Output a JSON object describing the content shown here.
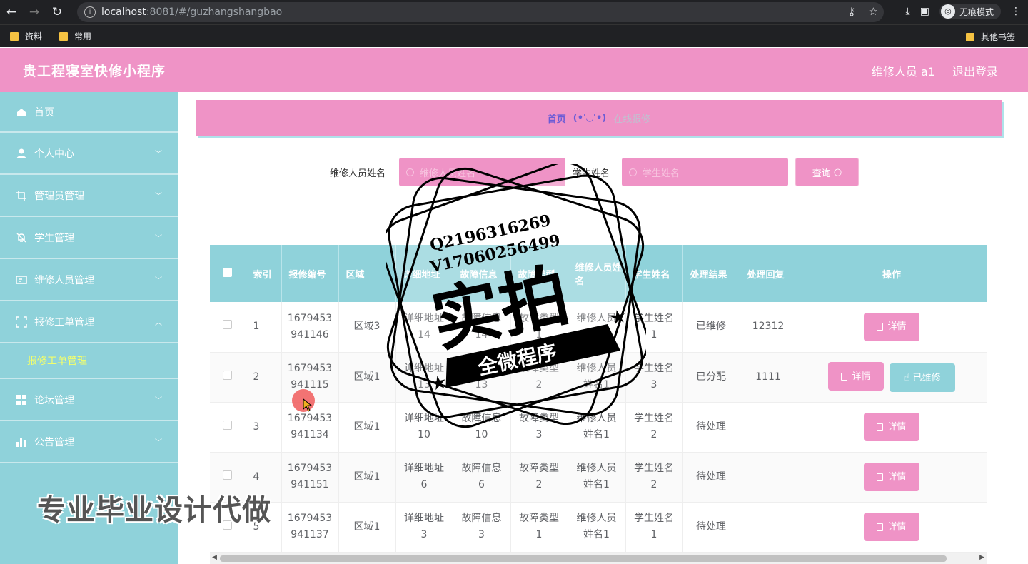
{
  "browser": {
    "url_host": "localhost",
    "url_path": ":8081/#/guzhangshangbao",
    "profile_label": "无痕模式",
    "bookmarks": [
      "资料",
      "常用"
    ],
    "other_bookmarks": "其他书签"
  },
  "header": {
    "title": "贵工程寝室快修小程序",
    "user": "维修人员 a1",
    "logout": "退出登录"
  },
  "sidebar": {
    "items": [
      {
        "label": "首页",
        "icon": "home-icon"
      },
      {
        "label": "个人中心",
        "icon": "user-icon"
      },
      {
        "label": "管理员管理",
        "icon": "crop-icon"
      },
      {
        "label": "学生管理",
        "icon": "bell-off-icon"
      },
      {
        "label": "维修人员管理",
        "icon": "card-icon"
      },
      {
        "label": "报修工单管理",
        "icon": "fullscreen-icon"
      },
      {
        "label": "论坛管理",
        "icon": "grid-icon"
      },
      {
        "label": "公告管理",
        "icon": "chart-icon"
      }
    ],
    "active_sub": "报修工单管理"
  },
  "breadcrumb": {
    "home": "首页",
    "face": "(•'◡'•)",
    "current": "在线报修"
  },
  "search": {
    "label1": "维修人员姓名",
    "placeholder1": "维修人员姓名",
    "label2": "学生姓名",
    "placeholder2": "学生姓名",
    "button": "查询"
  },
  "table": {
    "headers": [
      "索引",
      "报修编号",
      "区域",
      "详细地址",
      "故障信息",
      "故障类型",
      "维修人员姓名",
      "学生姓名",
      "处理结果",
      "处理回复",
      "操作"
    ],
    "rows": [
      {
        "idx": "1",
        "no1": "1679453",
        "no2": "941146",
        "area": "区域3",
        "addr1": "详细地址",
        "addr2": "14",
        "info1": "故障信息",
        "info2": "14",
        "type1": "故障类型",
        "type2": "1",
        "rep1": "维修人员",
        "rep2": "姓名1",
        "stu1": "学生姓名",
        "stu2": "1",
        "result": "已维修",
        "reply": "12312"
      },
      {
        "idx": "2",
        "no1": "1679453",
        "no2": "941115",
        "area": "区域1",
        "addr1": "详细地址",
        "addr2": "13",
        "info1": "故障信息",
        "info2": "13",
        "type1": "故障类型",
        "type2": "2",
        "rep1": "维修人员",
        "rep2": "姓名1",
        "stu1": "学生姓名",
        "stu2": "3",
        "result": "已分配",
        "reply": "1111"
      },
      {
        "idx": "3",
        "no1": "1679453",
        "no2": "941134",
        "area": "区域1",
        "addr1": "详细地址",
        "addr2": "10",
        "info1": "故障信息",
        "info2": "10",
        "type1": "故障类型",
        "type2": "3",
        "rep1": "维修人员",
        "rep2": "姓名1",
        "stu1": "学生姓名",
        "stu2": "2",
        "result": "待处理",
        "reply": ""
      },
      {
        "idx": "4",
        "no1": "1679453",
        "no2": "941151",
        "area": "区域1",
        "addr1": "详细地址",
        "addr2": "6",
        "info1": "故障信息",
        "info2": "6",
        "type1": "故障类型",
        "type2": "2",
        "rep1": "维修人员",
        "rep2": "姓名1",
        "stu1": "学生姓名",
        "stu2": "2",
        "result": "待处理",
        "reply": ""
      },
      {
        "idx": "5",
        "no1": "1679453",
        "no2": "941137",
        "area": "区域1",
        "addr1": "详细地址",
        "addr2": "3",
        "info1": "故障信息",
        "info2": "3",
        "type1": "故障类型",
        "type2": "1",
        "rep1": "维修人员",
        "rep2": "姓名1",
        "stu1": "学生姓名",
        "stu2": "1",
        "result": "待处理",
        "reply": ""
      }
    ],
    "detail_label": "详情",
    "repaired_label": "已维修"
  },
  "overlay": {
    "watermark": "专业毕业设计代做",
    "stamp_line1": "Q2196316269",
    "stamp_line2": "V17060256499",
    "stamp_main": "实拍",
    "stamp_banner": "全微程序"
  },
  "colors": {
    "pink": "#ef93c6",
    "teal": "#8fd2da",
    "sub_active": "#f3ff6b"
  }
}
